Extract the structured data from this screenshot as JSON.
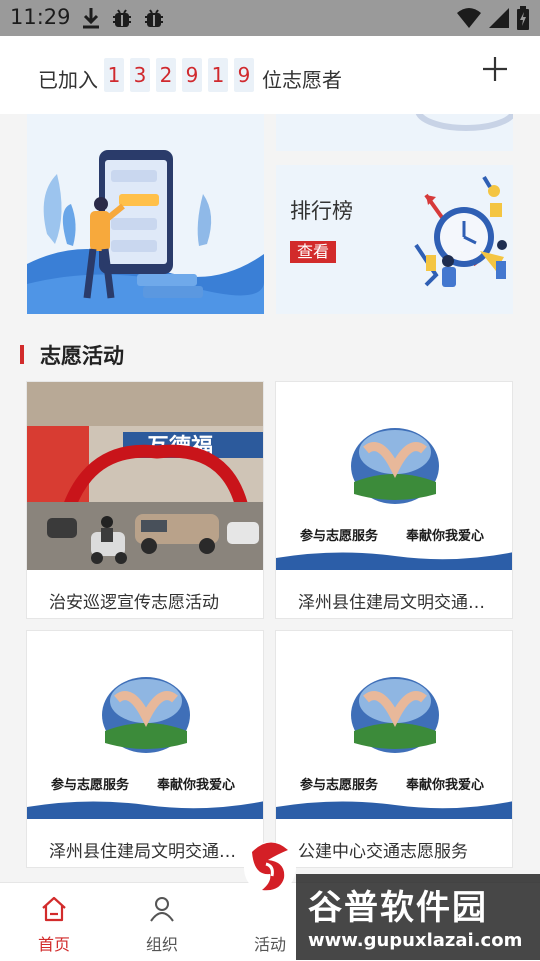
{
  "status_bar": {
    "time": "11:29"
  },
  "join": {
    "prefix": "已加入",
    "digits": [
      "1",
      "3",
      "2",
      "9",
      "1",
      "9"
    ],
    "suffix": "位志愿者"
  },
  "ranking": {
    "title": "排行榜",
    "button": "查看"
  },
  "section": {
    "title": "志愿活动"
  },
  "activities": [
    {
      "title": "治安巡逻宣传志愿活动"
    },
    {
      "title": "泽州县住建局文明交通志愿服务"
    },
    {
      "title": "泽州县住建局文明交通志愿服务"
    },
    {
      "title": "公建中心交通志愿服务"
    }
  ],
  "poster": {
    "left_text": "参与志愿服务",
    "right_text": "奉献你我爱心"
  },
  "storefront": {
    "sign": "互德福"
  },
  "tabs": [
    {
      "label": "首页",
      "icon": "home-icon",
      "active": true
    },
    {
      "label": "组织",
      "icon": "person-icon",
      "active": false
    },
    {
      "label": "活动",
      "icon": "activity-icon",
      "active": false
    }
  ],
  "watermark": {
    "title": "谷普软件园",
    "url": "www.gupuxlazai.com"
  },
  "colors": {
    "accent": "#d22b2b",
    "banner_bg": "#edf4fb",
    "digit_bg": "#eaf1f8"
  }
}
